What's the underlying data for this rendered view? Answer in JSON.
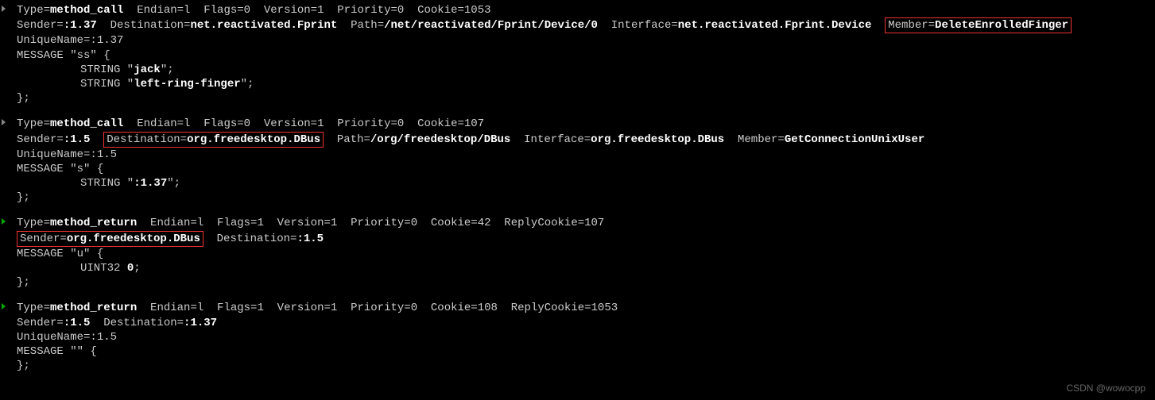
{
  "messages": [
    {
      "marker": "grey",
      "header": [
        {
          "t": "Type=",
          "b": false
        },
        {
          "t": "method_call",
          "b": true
        },
        {
          "t": "  Endian=l  Flags=0  Version=1  Priority=0  Cookie=1053",
          "b": false
        }
      ],
      "header2": [
        {
          "t": "Sender=",
          "b": false
        },
        {
          "t": ":1.37",
          "b": true
        },
        {
          "t": "  Destination=",
          "b": false
        },
        {
          "t": "net.reactivated.Fprint",
          "b": true
        },
        {
          "t": "  Path=",
          "b": false
        },
        {
          "t": "/net/reactivated/Fprint/Device/0",
          "b": true
        },
        {
          "t": "  Interface=",
          "b": false
        },
        {
          "t": "net.reactivated.Fprint.Device",
          "b": true
        },
        {
          "t": "  ",
          "b": false
        },
        {
          "box": true,
          "parts": [
            {
              "t": "Member=",
              "b": false
            },
            {
              "t": "DeleteEnrolledFinger",
              "b": true
            }
          ]
        }
      ],
      "lines": [
        [
          {
            "t": "UniqueName=:1.37",
            "b": false
          }
        ],
        [
          {
            "t": "MESSAGE \"ss\" {",
            "b": false
          }
        ],
        [
          {
            "pad": true,
            "t": "STRING \"",
            "b": false
          },
          {
            "t": "jack",
            "b": true
          },
          {
            "t": "\";",
            "b": false
          }
        ],
        [
          {
            "pad": true,
            "t": "STRING \"",
            "b": false
          },
          {
            "t": "left-ring-finger",
            "b": true
          },
          {
            "t": "\";",
            "b": false
          }
        ],
        [
          {
            "t": "};",
            "b": false
          }
        ]
      ]
    },
    {
      "marker": "grey",
      "header": [
        {
          "t": "Type=",
          "b": false
        },
        {
          "t": "method_call",
          "b": true
        },
        {
          "t": "  Endian=l  Flags=0  Version=1  Priority=0  Cookie=107",
          "b": false
        }
      ],
      "header2": [
        {
          "t": "Sender=",
          "b": false
        },
        {
          "t": ":1.5",
          "b": true
        },
        {
          "t": "  ",
          "b": false
        },
        {
          "box": true,
          "parts": [
            {
              "t": "Destination=",
              "b": false
            },
            {
              "t": "org.freedesktop.DBus",
              "b": true
            }
          ]
        },
        {
          "t": "  Path=",
          "b": false
        },
        {
          "t": "/org/freedesktop/DBus",
          "b": true
        },
        {
          "t": "  Interface=",
          "b": false
        },
        {
          "t": "org.freedesktop.DBus",
          "b": true
        },
        {
          "t": "  Member=",
          "b": false
        },
        {
          "t": "GetConnectionUnixUser",
          "b": true
        }
      ],
      "lines": [
        [
          {
            "t": "UniqueName=:1.5",
            "b": false
          }
        ],
        [
          {
            "t": "MESSAGE \"s\" {",
            "b": false
          }
        ],
        [
          {
            "pad": true,
            "t": "STRING \"",
            "b": false
          },
          {
            "t": ":1.37",
            "b": true
          },
          {
            "t": "\";",
            "b": false
          }
        ],
        [
          {
            "t": "};",
            "b": false
          }
        ]
      ]
    },
    {
      "marker": "green",
      "header": [
        {
          "t": "Type=",
          "b": false
        },
        {
          "t": "method_return",
          "b": true
        },
        {
          "t": "  Endian=l  Flags=1  Version=1  Priority=0  Cookie=42  ReplyCookie=107",
          "b": false
        }
      ],
      "header2": [
        {
          "box": true,
          "parts": [
            {
              "t": "Sender=",
              "b": false
            },
            {
              "t": "org.freedesktop.DBus",
              "b": true
            }
          ]
        },
        {
          "t": "  Destination=",
          "b": false
        },
        {
          "t": ":1.5",
          "b": true
        }
      ],
      "lines": [
        [
          {
            "t": "MESSAGE \"u\" {",
            "b": false
          }
        ],
        [
          {
            "pad": true,
            "t": "UINT32 ",
            "b": false
          },
          {
            "t": "0",
            "b": true
          },
          {
            "t": ";",
            "b": false
          }
        ],
        [
          {
            "t": "};",
            "b": false
          }
        ]
      ]
    },
    {
      "marker": "green",
      "header": [
        {
          "t": "Type=",
          "b": false
        },
        {
          "t": "method_return",
          "b": true
        },
        {
          "t": "  Endian=l  Flags=1  Version=1  Priority=0  Cookie=108  ReplyCookie=1053",
          "b": false
        }
      ],
      "header2": [
        {
          "t": "Sender=",
          "b": false
        },
        {
          "t": ":1.5",
          "b": true
        },
        {
          "t": "  Destination=",
          "b": false
        },
        {
          "t": ":1.37",
          "b": true
        }
      ],
      "lines": [
        [
          {
            "t": "UniqueName=:1.5",
            "b": false
          }
        ],
        [
          {
            "t": "MESSAGE \"\" {",
            "b": false
          }
        ],
        [
          {
            "t": "};",
            "b": false
          }
        ]
      ]
    }
  ],
  "watermark": "CSDN @wowocpp"
}
